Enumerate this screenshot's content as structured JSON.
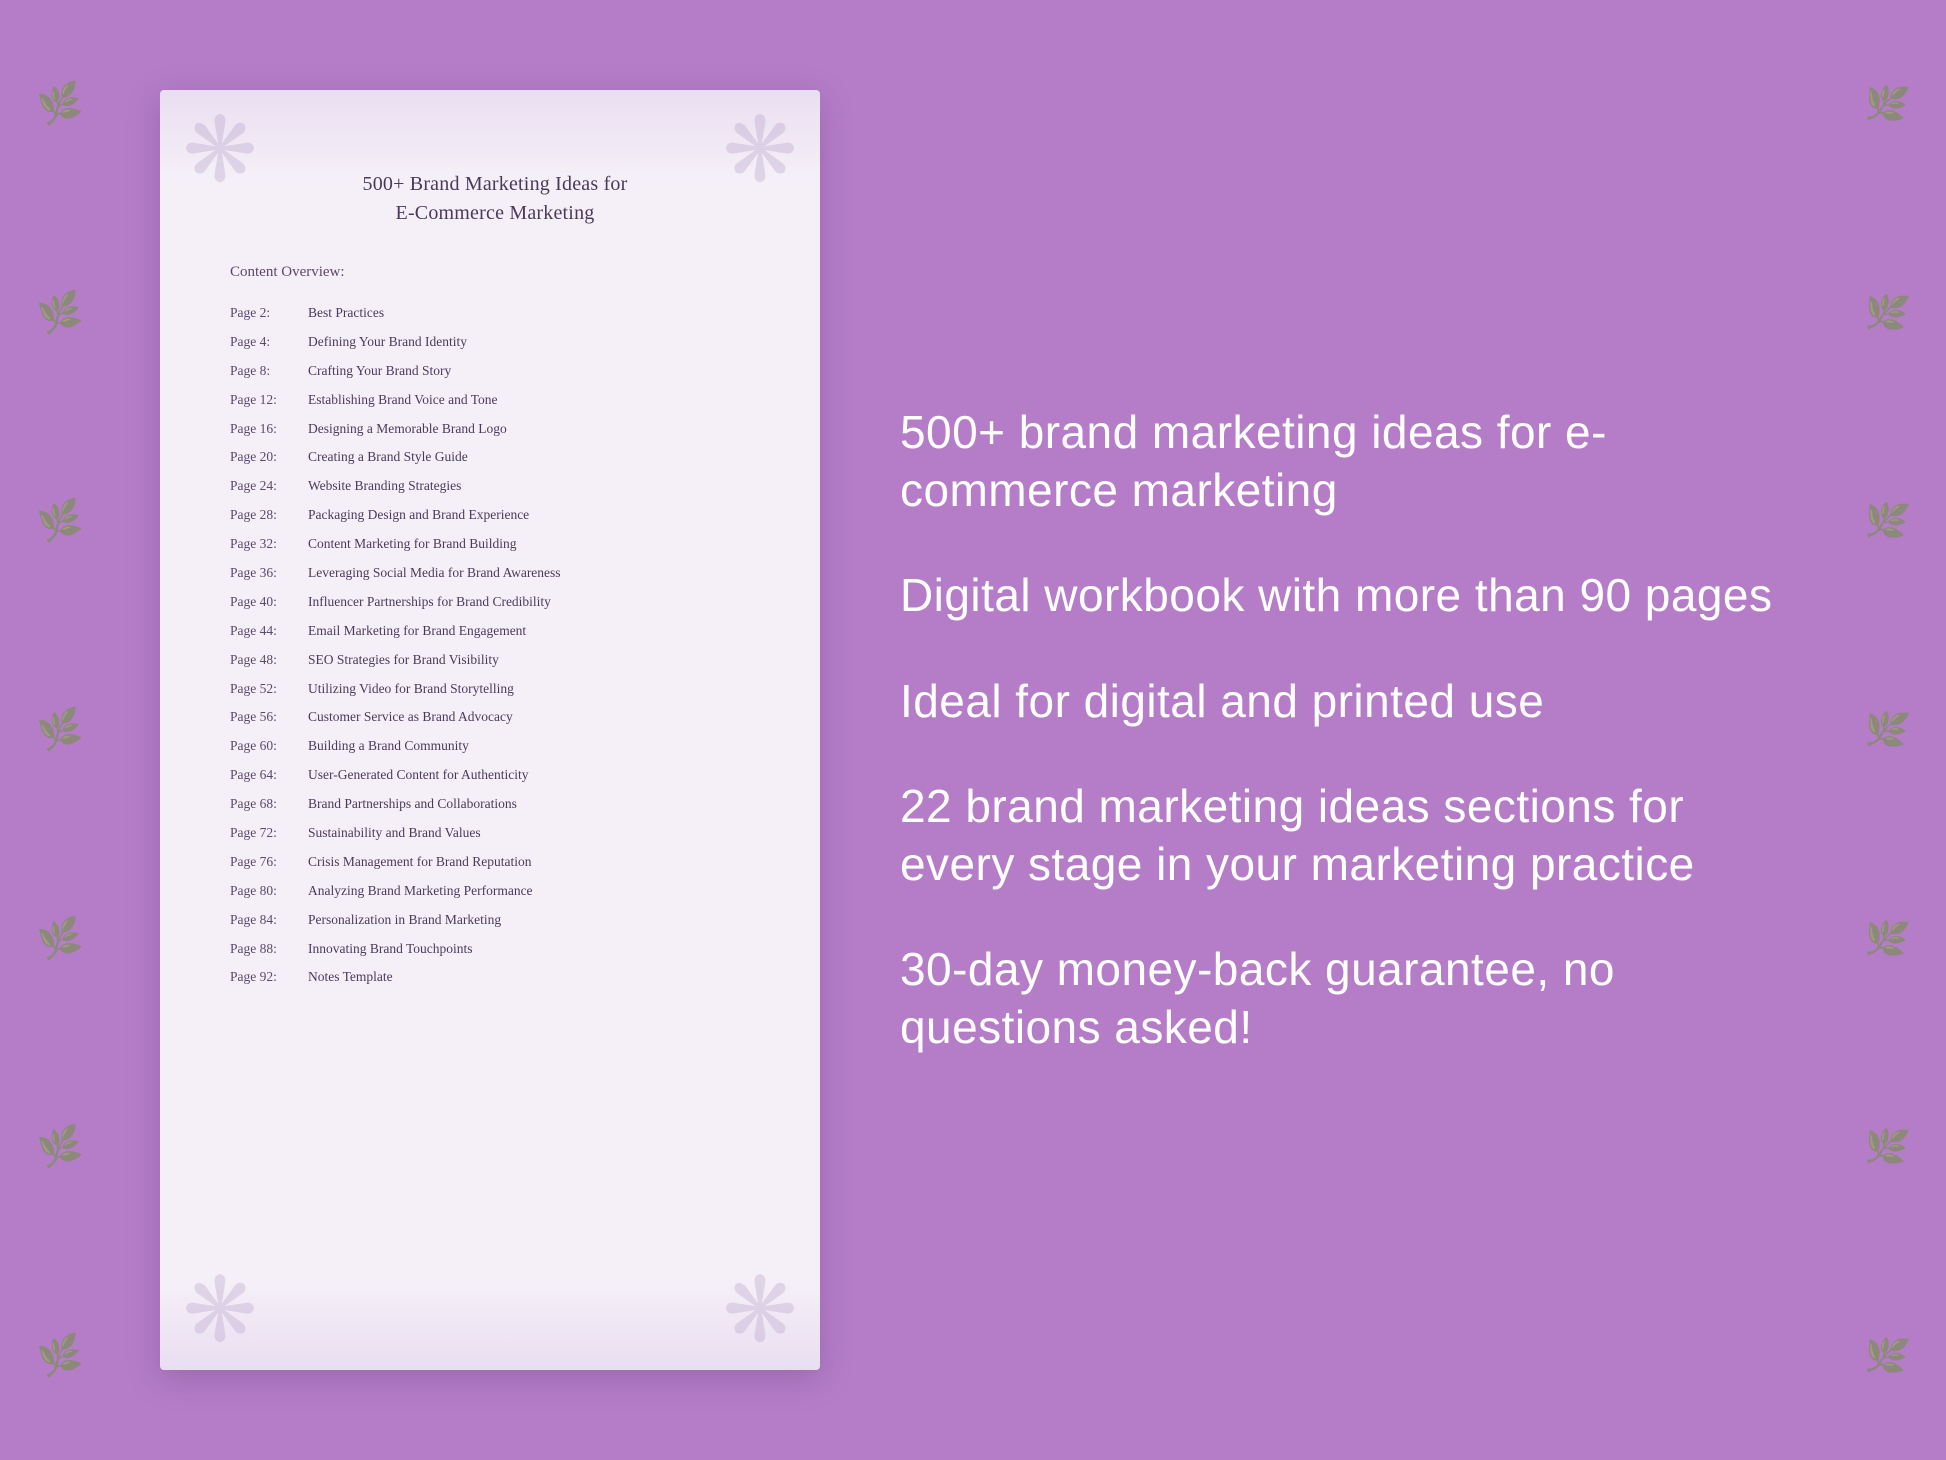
{
  "background": {
    "color": "#b77ecb"
  },
  "doc": {
    "title_line1": "500+ Brand Marketing Ideas for",
    "title_line2": "E-Commerce Marketing",
    "content_overview_label": "Content Overview:",
    "toc_items": [
      {
        "page": "Page  2:",
        "text": "Best Practices"
      },
      {
        "page": "Page  4:",
        "text": "Defining Your Brand Identity"
      },
      {
        "page": "Page  8:",
        "text": "Crafting Your Brand Story"
      },
      {
        "page": "Page 12:",
        "text": "Establishing Brand Voice and Tone"
      },
      {
        "page": "Page 16:",
        "text": "Designing a Memorable Brand Logo"
      },
      {
        "page": "Page 20:",
        "text": "Creating a Brand Style Guide"
      },
      {
        "page": "Page 24:",
        "text": "Website Branding Strategies"
      },
      {
        "page": "Page 28:",
        "text": "Packaging Design and Brand Experience"
      },
      {
        "page": "Page 32:",
        "text": "Content Marketing for Brand Building"
      },
      {
        "page": "Page 36:",
        "text": "Leveraging Social Media for Brand Awareness"
      },
      {
        "page": "Page 40:",
        "text": "Influencer Partnerships for Brand Credibility"
      },
      {
        "page": "Page 44:",
        "text": "Email Marketing for Brand Engagement"
      },
      {
        "page": "Page 48:",
        "text": "SEO Strategies for Brand Visibility"
      },
      {
        "page": "Page 52:",
        "text": "Utilizing Video for Brand Storytelling"
      },
      {
        "page": "Page 56:",
        "text": "Customer Service as Brand Advocacy"
      },
      {
        "page": "Page 60:",
        "text": "Building a Brand Community"
      },
      {
        "page": "Page 64:",
        "text": "User-Generated Content for Authenticity"
      },
      {
        "page": "Page 68:",
        "text": "Brand Partnerships and Collaborations"
      },
      {
        "page": "Page 72:",
        "text": "Sustainability and Brand Values"
      },
      {
        "page": "Page 76:",
        "text": "Crisis Management for Brand Reputation"
      },
      {
        "page": "Page 80:",
        "text": "Analyzing Brand Marketing Performance"
      },
      {
        "page": "Page 84:",
        "text": "Personalization in Brand Marketing"
      },
      {
        "page": "Page 88:",
        "text": "Innovating Brand Touchpoints"
      },
      {
        "page": "Page 92:",
        "text": "Notes Template"
      }
    ]
  },
  "features": [
    "500+ brand marketing ideas for e-commerce marketing",
    "Digital workbook with more than 90 pages",
    "Ideal for digital and printed use",
    "22 brand marketing ideas sections for every stage in your marketing practice",
    "30-day money-back guarantee, no questions asked!"
  ],
  "floral_symbol": "✿",
  "watermark_symbol": "❋"
}
